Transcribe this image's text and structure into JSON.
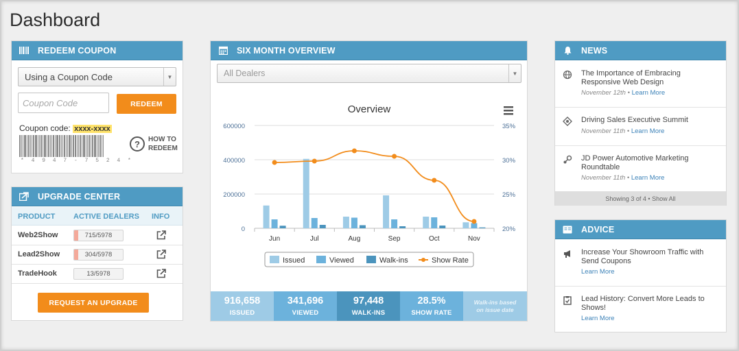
{
  "page": {
    "title": "Dashboard"
  },
  "colors": {
    "header": "#4f9bc3",
    "orange": "#f28c1b",
    "issued": "#9ecbe6",
    "viewed": "#6cb2dc",
    "walkins": "#4b94bd",
    "show_rate": "#f28c1b"
  },
  "redeem": {
    "header": "REDEEM COUPON",
    "header_icon": "barcode-icon",
    "select_value": "Using a Coupon Code",
    "coupon_placeholder": "Coupon Code",
    "redeem_label": "REDEEM",
    "coupon_code_label": "Coupon code:",
    "coupon_code_value": "xxxx-xxxx",
    "barcode_digits": "* 4 9 4 7 - 7 5 2 4 *",
    "howto_label_1": "HOW TO",
    "howto_label_2": "REDEEM"
  },
  "upgrade": {
    "header": "UPGRADE CENTER",
    "header_icon": "upgrade-icon",
    "columns": [
      "PRODUCT",
      "ACTIVE DEALERS",
      "INFO"
    ],
    "rows": [
      {
        "product": "Web2Show",
        "active": "715/5978",
        "fraction": 0.12
      },
      {
        "product": "Lead2Show",
        "active": "304/5978",
        "fraction": 0.05
      },
      {
        "product": "TradeHook",
        "active": "13/5978",
        "fraction": 0.002
      }
    ],
    "button": "REQUEST AN UPGRADE"
  },
  "overview": {
    "header": "SIX MONTH OVERVIEW",
    "header_icon": "calendar-icon",
    "dealer_select": "All Dealers",
    "stats": [
      {
        "value": "916,658",
        "label": "ISSUED",
        "color": "#9ecbe6"
      },
      {
        "value": "341,696",
        "label": "VIEWED",
        "color": "#6cb2dc"
      },
      {
        "value": "97,448",
        "label": "WALK-INS",
        "color": "#4b94bd"
      },
      {
        "value": "28.5%",
        "label": "SHOW RATE",
        "color": "#6cb2dc"
      }
    ],
    "note_line1": "Walk-ins based",
    "note_line2": "on issue date"
  },
  "chart_data": {
    "type": "bar",
    "title": "Overview",
    "categories": [
      "Jun",
      "Jul",
      "Aug",
      "Sep",
      "Oct",
      "Nov"
    ],
    "ylim": [
      0,
      600000
    ],
    "y2lim": [
      20,
      35
    ],
    "yticks": [
      "0",
      "200000",
      "400000",
      "600000"
    ],
    "y2ticks": [
      "20%",
      "25%",
      "30%",
      "35%"
    ],
    "series": [
      {
        "name": "Issued",
        "type": "bar",
        "values": [
          133000,
          405000,
          68000,
          192000,
          68000,
          35000
        ]
      },
      {
        "name": "Viewed",
        "type": "bar",
        "values": [
          52000,
          60000,
          62000,
          52000,
          64000,
          30000
        ]
      },
      {
        "name": "Walk-ins",
        "type": "bar",
        "values": [
          15000,
          20000,
          18000,
          12000,
          16000,
          5000
        ]
      },
      {
        "name": "Show Rate",
        "type": "line",
        "axis": "right",
        "values": [
          29.6,
          29.8,
          31.3,
          30.5,
          27.0,
          21.0
        ]
      }
    ],
    "legend": "bottom",
    "grid": true
  },
  "news": {
    "header": "NEWS",
    "header_icon": "bell-icon",
    "items": [
      {
        "icon": "globe-icon",
        "title": "The Importance of Embracing Responsive Web Design",
        "date": "November 12th",
        "link": "Learn More"
      },
      {
        "icon": "target-icon",
        "title": "Driving Sales Executive Summit",
        "date": "November 11th",
        "link": "Learn More"
      },
      {
        "icon": "nodes-icon",
        "title": "JD Power Automotive Marketing Roundtable",
        "date": "November 11th",
        "link": "Learn More"
      }
    ],
    "footer": "Showing 3 of 4 • Show All",
    "bullet": " • "
  },
  "advice": {
    "header": "ADVICE",
    "header_icon": "book-icon",
    "items": [
      {
        "icon": "megaphone-icon",
        "title": "Increase Your Showroom Traffic with Send Coupons",
        "link": "Learn More"
      },
      {
        "icon": "clipboard-icon",
        "title": "Lead History: Convert More Leads to Shows!",
        "link": "Learn More"
      }
    ]
  }
}
